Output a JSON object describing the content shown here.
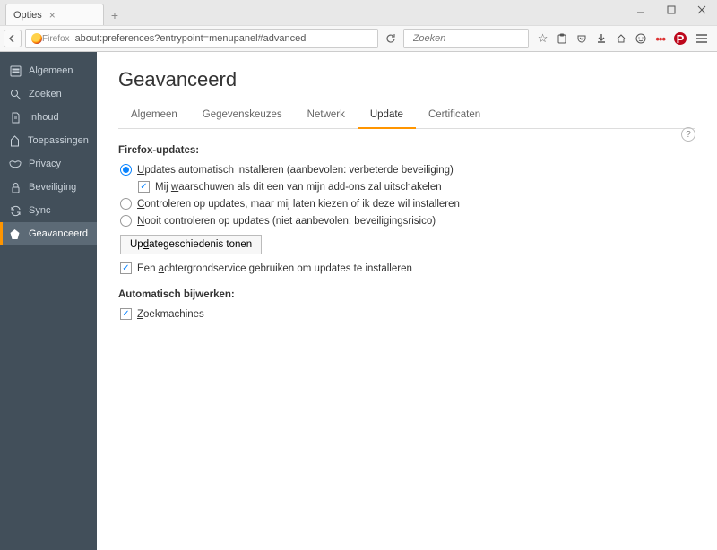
{
  "window": {
    "tab_title": "Opties"
  },
  "urlbar": {
    "brand": "Firefox",
    "url": "about:preferences?entrypoint=menupanel#advanced"
  },
  "searchbar": {
    "placeholder": "Zoeken"
  },
  "sidebar": {
    "items": [
      {
        "label": "Algemeen"
      },
      {
        "label": "Zoeken"
      },
      {
        "label": "Inhoud"
      },
      {
        "label": "Toepassingen"
      },
      {
        "label": "Privacy"
      },
      {
        "label": "Beveiliging"
      },
      {
        "label": "Sync"
      },
      {
        "label": "Geavanceerd"
      }
    ]
  },
  "page": {
    "title": "Geavanceerd",
    "subtabs": [
      {
        "label": "Algemeen"
      },
      {
        "label": "Gegevenskeuzes"
      },
      {
        "label": "Netwerk"
      },
      {
        "label": "Update"
      },
      {
        "label": "Certificaten"
      }
    ],
    "section1_title": "Firefox-updates:",
    "radio1_pre": "U",
    "radio1_rest": "pdates automatisch installeren (aanbevolen: verbeterde beveiliging)",
    "check1_pre": "Mij ",
    "check1_u": "w",
    "check1_rest": "aarschuwen als dit een van mijn add-ons zal uitschakelen",
    "radio2_pre": "C",
    "radio2_rest": "ontroleren op updates, maar mij laten kiezen of ik deze wil installeren",
    "radio3_pre": "N",
    "radio3_rest": "ooit controleren op updates (niet aanbevolen: beveiligingsrisico)",
    "history_btn_pre": "Up",
    "history_btn_u": "d",
    "history_btn_rest": "ategeschiedenis tonen",
    "check2_pre": "Een ",
    "check2_u": "a",
    "check2_rest": "chtergrondservice gebruiken om updates te installeren",
    "section2_title": "Automatisch bijwerken:",
    "check3_pre": "Z",
    "check3_rest": "oekmachines"
  }
}
